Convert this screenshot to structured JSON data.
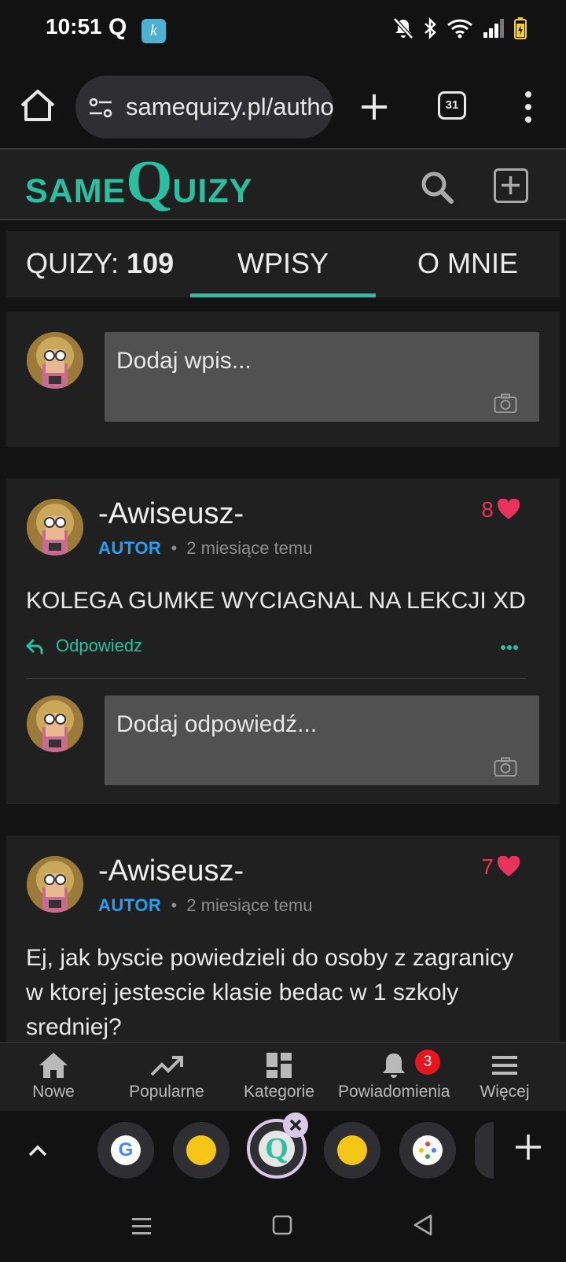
{
  "status_bar": {
    "time": "10:51",
    "q_glyph": "Q",
    "app_icon_glyph": "k",
    "icons": [
      "mute-icon",
      "bluetooth-icon",
      "wifi-icon",
      "signal-icon",
      "battery-icon"
    ]
  },
  "browser": {
    "url": "samequizy.pl/author/-Awiseusz-",
    "tab_count": "31"
  },
  "site": {
    "logo_same": "SAME",
    "logo_q": "Q",
    "logo_uizy": "UIZY",
    "accent_color": "#2bbf9f"
  },
  "profile_tabs": {
    "quizy_label": "QUIZY:",
    "quizy_count": "109",
    "wpisy_label": "WPISY",
    "omnie_label": "O MNIE"
  },
  "composer": {
    "placeholder": "Dodaj wpis..."
  },
  "posts": [
    {
      "author": "-Awiseusz-",
      "role": "AUTOR",
      "separator": "•",
      "time": "2 miesiące temu",
      "likes": "8",
      "text": "KOLEGA GUMKE WYCIAGNAL NA LEKCJI XD",
      "reply_label": "Odpowiedz",
      "reply_placeholder": "Dodaj odpowiedź..."
    },
    {
      "author": "-Awiseusz-",
      "role": "AUTOR",
      "separator": "•",
      "time": "2 miesiące temu",
      "likes": "7",
      "text": "Ej, jak byscie powiedzieli do osoby z zagranicy w ktorej jestescie klasie bedac w 1 szkoly sredniej?"
    }
  ],
  "site_nav": {
    "items": [
      {
        "label": "Nowe",
        "icon": "home-icon"
      },
      {
        "label": "Popularne",
        "icon": "trending-icon"
      },
      {
        "label": "Kategorie",
        "icon": "dashboard-icon"
      },
      {
        "label": "Powiadomienia",
        "icon": "bell-icon",
        "badge": "3"
      },
      {
        "label": "Więcej",
        "icon": "menu-icon"
      }
    ]
  },
  "tab_strip": {
    "active_glyph": "Q",
    "google_glyph": "G"
  }
}
